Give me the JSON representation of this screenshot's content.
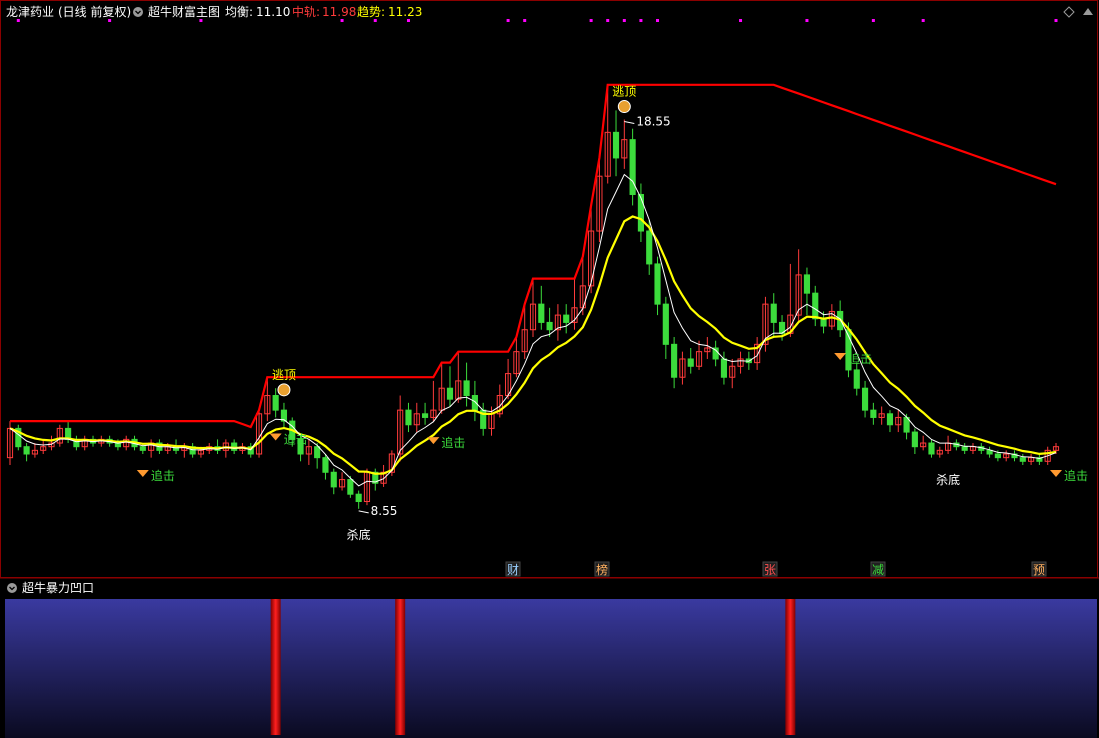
{
  "header": {
    "stock_name": "龙津药业",
    "period_info": "(日线 前复权)",
    "indicator_name": "超牛财富主图",
    "balance_label": "均衡:",
    "balance_value": "11.10",
    "mid_label": "中轨:",
    "mid_value": "11.98",
    "trend_label": "趋势:",
    "trend_value": "11.23"
  },
  "sub_panel": {
    "title": "超牛暴力凹口"
  },
  "bottom_markers": [
    "财",
    "榜",
    "张",
    "减",
    "预"
  ],
  "colors": {
    "up": "#ff3b3b",
    "down": "#3cdc3c",
    "trend_line": "#ffff00",
    "balance_line": "#ffffff",
    "mid_line": "#ff0000",
    "accent_magenta": "#ff00ff",
    "panel_bg_top": "#3a3aa0",
    "panel_bg_bottom": "#0a0a20"
  },
  "chart_data": {
    "type": "candlestick",
    "price_range": [
      6.5,
      21.0
    ],
    "candles": [
      [
        9.3,
        10.1,
        10.3,
        9.1
      ],
      [
        10.1,
        9.6,
        10.2,
        9.5
      ],
      [
        9.6,
        9.4,
        9.7,
        9.2
      ],
      [
        9.4,
        9.5,
        9.7,
        9.3
      ],
      [
        9.5,
        9.6,
        9.8,
        9.4
      ],
      [
        9.6,
        9.7,
        9.9,
        9.5
      ],
      [
        9.7,
        10.1,
        10.2,
        9.6
      ],
      [
        10.1,
        9.8,
        10.3,
        9.7
      ],
      [
        9.8,
        9.6,
        9.9,
        9.5
      ],
      [
        9.6,
        9.8,
        9.9,
        9.5
      ],
      [
        9.8,
        9.7,
        9.9,
        9.6
      ],
      [
        9.7,
        9.8,
        9.9,
        9.6
      ],
      [
        9.8,
        9.7,
        9.9,
        9.6
      ],
      [
        9.7,
        9.6,
        9.8,
        9.5
      ],
      [
        9.6,
        9.8,
        9.9,
        9.5
      ],
      [
        9.8,
        9.6,
        9.9,
        9.5
      ],
      [
        9.6,
        9.5,
        9.7,
        9.4
      ],
      [
        9.5,
        9.7,
        9.8,
        9.3
      ],
      [
        9.7,
        9.5,
        9.8,
        9.4
      ],
      [
        9.5,
        9.6,
        9.7,
        9.4
      ],
      [
        9.6,
        9.5,
        9.8,
        9.4
      ],
      [
        9.5,
        9.6,
        9.7,
        9.3
      ],
      [
        9.6,
        9.4,
        9.7,
        9.3
      ],
      [
        9.4,
        9.5,
        9.6,
        9.3
      ],
      [
        9.5,
        9.6,
        9.7,
        9.4
      ],
      [
        9.6,
        9.5,
        9.8,
        9.4
      ],
      [
        9.5,
        9.7,
        9.8,
        9.3
      ],
      [
        9.7,
        9.5,
        9.8,
        9.4
      ],
      [
        9.5,
        9.6,
        9.7,
        9.4
      ],
      [
        9.6,
        9.4,
        9.7,
        9.3
      ],
      [
        9.4,
        10.5,
        10.6,
        9.3
      ],
      [
        10.5,
        11.0,
        11.5,
        10.3
      ],
      [
        11.0,
        10.6,
        11.2,
        10.4
      ],
      [
        10.6,
        10.3,
        10.8,
        10.1
      ],
      [
        10.3,
        9.8,
        10.4,
        9.6
      ],
      [
        9.8,
        9.4,
        9.9,
        9.2
      ],
      [
        9.4,
        9.6,
        9.8,
        9.1
      ],
      [
        9.6,
        9.3,
        9.7,
        9.0
      ],
      [
        9.3,
        8.9,
        9.4,
        8.7
      ],
      [
        8.9,
        8.5,
        9.0,
        8.3
      ],
      [
        8.5,
        8.7,
        8.9,
        8.4
      ],
      [
        8.7,
        8.3,
        8.8,
        8.2
      ],
      [
        8.3,
        8.1,
        8.4,
        7.9
      ],
      [
        8.1,
        8.9,
        9.0,
        8.0
      ],
      [
        8.9,
        8.6,
        9.0,
        8.4
      ],
      [
        8.6,
        8.9,
        9.1,
        8.5
      ],
      [
        8.9,
        9.4,
        9.5,
        8.8
      ],
      [
        9.4,
        10.6,
        11.0,
        9.2
      ],
      [
        10.6,
        10.2,
        10.8,
        10.0
      ],
      [
        10.2,
        10.5,
        10.8,
        10.0
      ],
      [
        10.5,
        10.4,
        10.8,
        10.2
      ],
      [
        10.4,
        10.6,
        11.4,
        10.3
      ],
      [
        10.6,
        11.2,
        11.9,
        10.5
      ],
      [
        11.2,
        10.9,
        11.8,
        10.7
      ],
      [
        10.9,
        11.4,
        12.2,
        10.8
      ],
      [
        11.4,
        11.0,
        11.9,
        10.7
      ],
      [
        11.0,
        10.6,
        11.4,
        10.3
      ],
      [
        10.6,
        10.1,
        10.8,
        9.9
      ],
      [
        10.1,
        10.5,
        10.7,
        9.9
      ],
      [
        10.5,
        11.0,
        11.3,
        10.4
      ],
      [
        11.0,
        11.6,
        12.0,
        10.9
      ],
      [
        11.6,
        12.2,
        12.6,
        11.5
      ],
      [
        12.2,
        12.8,
        13.5,
        12.0
      ],
      [
        12.8,
        13.5,
        14.2,
        12.6
      ],
      [
        13.5,
        13.0,
        14.0,
        12.8
      ],
      [
        13.0,
        12.8,
        13.4,
        12.6
      ],
      [
        12.8,
        13.2,
        13.5,
        12.5
      ],
      [
        13.2,
        13.0,
        13.5,
        12.7
      ],
      [
        13.0,
        13.4,
        14.2,
        12.8
      ],
      [
        13.4,
        14.0,
        14.8,
        13.2
      ],
      [
        14.0,
        15.5,
        16.2,
        13.8
      ],
      [
        15.5,
        17.0,
        17.5,
        15.2
      ],
      [
        17.0,
        18.2,
        19.5,
        16.8
      ],
      [
        18.2,
        17.5,
        18.8,
        17.0
      ],
      [
        17.5,
        18.0,
        18.55,
        17.2
      ],
      [
        18.0,
        16.5,
        18.3,
        16.2
      ],
      [
        16.5,
        15.5,
        16.8,
        15.2
      ],
      [
        15.5,
        14.6,
        15.8,
        14.3
      ],
      [
        14.6,
        13.5,
        14.8,
        13.2
      ],
      [
        13.5,
        12.4,
        13.7,
        12.0
      ],
      [
        12.4,
        11.5,
        12.6,
        11.2
      ],
      [
        11.5,
        12.0,
        12.2,
        11.3
      ],
      [
        12.0,
        11.8,
        12.3,
        11.6
      ],
      [
        11.8,
        12.2,
        12.5,
        11.7
      ],
      [
        12.2,
        12.3,
        12.6,
        12.0
      ],
      [
        12.3,
        12.0,
        12.5,
        11.8
      ],
      [
        12.0,
        11.5,
        12.2,
        11.3
      ],
      [
        11.5,
        11.8,
        12.0,
        11.2
      ],
      [
        11.8,
        12.0,
        12.2,
        11.6
      ],
      [
        12.0,
        11.9,
        12.2,
        11.7
      ],
      [
        11.9,
        12.4,
        12.6,
        11.7
      ],
      [
        12.4,
        13.5,
        13.7,
        12.2
      ],
      [
        13.5,
        13.0,
        13.8,
        12.6
      ],
      [
        13.0,
        12.7,
        13.2,
        12.5
      ],
      [
        12.7,
        13.2,
        14.6,
        12.6
      ],
      [
        13.2,
        14.3,
        15.0,
        13.0
      ],
      [
        14.3,
        13.8,
        14.5,
        13.2
      ],
      [
        13.8,
        13.1,
        14.0,
        12.9
      ],
      [
        13.1,
        12.9,
        13.3,
        12.7
      ],
      [
        12.9,
        13.3,
        13.5,
        12.8
      ],
      [
        13.3,
        12.8,
        13.6,
        12.6
      ],
      [
        12.8,
        11.7,
        13.0,
        11.5
      ],
      [
        11.7,
        11.2,
        11.9,
        11.0
      ],
      [
        11.2,
        10.6,
        11.4,
        10.4
      ],
      [
        10.6,
        10.4,
        10.8,
        10.2
      ],
      [
        10.4,
        10.5,
        10.7,
        10.2
      ],
      [
        10.5,
        10.2,
        10.6,
        10.0
      ],
      [
        10.2,
        10.4,
        10.6,
        10.0
      ],
      [
        10.4,
        10.0,
        10.5,
        9.8
      ],
      [
        10.0,
        9.6,
        10.1,
        9.4
      ],
      [
        9.6,
        9.7,
        9.9,
        9.5
      ],
      [
        9.7,
        9.4,
        9.8,
        9.3
      ],
      [
        9.4,
        9.5,
        9.6,
        9.3
      ],
      [
        9.5,
        9.7,
        9.9,
        9.4
      ],
      [
        9.7,
        9.6,
        9.8,
        9.5
      ],
      [
        9.6,
        9.5,
        9.7,
        9.4
      ],
      [
        9.5,
        9.6,
        9.7,
        9.4
      ],
      [
        9.6,
        9.5,
        9.7,
        9.4
      ],
      [
        9.5,
        9.4,
        9.6,
        9.3
      ],
      [
        9.4,
        9.3,
        9.5,
        9.2
      ],
      [
        9.3,
        9.4,
        9.5,
        9.2
      ],
      [
        9.4,
        9.3,
        9.5,
        9.2
      ],
      [
        9.3,
        9.2,
        9.4,
        9.1
      ],
      [
        9.2,
        9.3,
        9.4,
        9.1
      ],
      [
        9.3,
        9.2,
        9.4,
        9.1
      ],
      [
        9.2,
        9.5,
        9.6,
        9.1
      ],
      [
        9.5,
        9.6,
        9.7,
        9.4
      ]
    ],
    "annotations": [
      {
        "text": "逃顶",
        "index": 33,
        "color": "#ffff00"
      },
      {
        "text": "逃顶",
        "index": 74,
        "color": "#ffff00"
      },
      {
        "text": "追击",
        "index": 16,
        "color": "#3cdc3c"
      },
      {
        "text": "追击",
        "index": 32,
        "color": "#3cdc3c"
      },
      {
        "text": "追击",
        "index": 51,
        "color": "#3cdc3c"
      },
      {
        "text": "追击",
        "index": 100,
        "color": "#3cdc3c"
      },
      {
        "text": "追击",
        "index": 126,
        "color": "#3cdc3c"
      },
      {
        "text": "杀底",
        "index": 42,
        "color": "#ffffff"
      },
      {
        "text": "杀底",
        "index": 113,
        "color": "#ffffff"
      },
      {
        "text": "18.55",
        "index": 74,
        "color": "#ffffff"
      },
      {
        "text": "8.55",
        "index": 42,
        "color": "#ffffff"
      }
    ],
    "subpanel_bars": [
      32,
      47,
      94
    ]
  }
}
